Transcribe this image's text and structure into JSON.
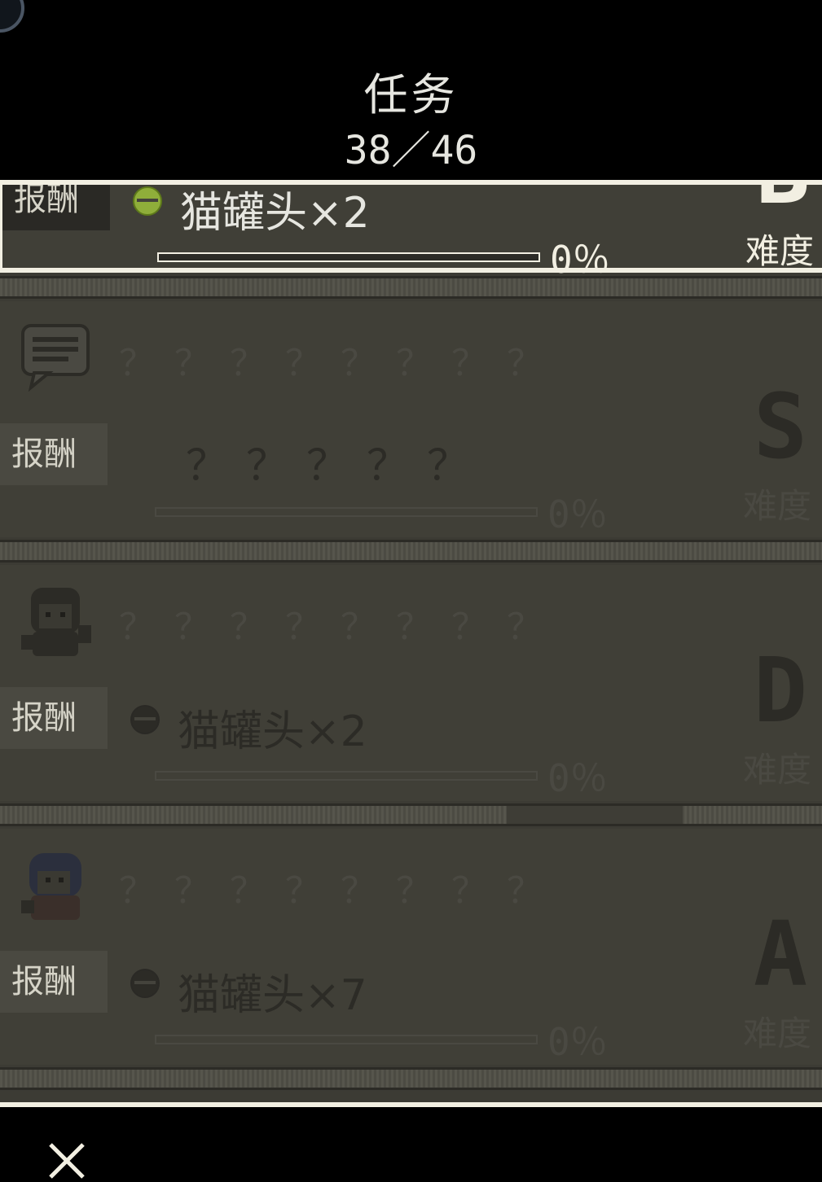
{
  "header": {
    "title": "任务",
    "count": "38／46"
  },
  "quests": [
    {
      "reward_label": "报酬",
      "reward": "猫罐头×2",
      "percent": "0％",
      "progress": 0,
      "grade": "B",
      "grade_label": "难度"
    },
    {
      "icon": "speech-bubble-icon",
      "title": "？？？？？？？？",
      "reward_label": "报酬",
      "reward": "？？？？？",
      "percent": "0％",
      "progress": 0,
      "grade": "S",
      "grade_label": "难度"
    },
    {
      "icon": "character-portrait-icon",
      "title": "？？？？？？？？",
      "reward_label": "报酬",
      "reward": "猫罐头×2",
      "percent": "0％",
      "progress": 0,
      "grade": "D",
      "grade_label": "难度"
    },
    {
      "icon": "character-portrait-icon",
      "title": "？？？？？？？？",
      "reward_label": "报酬",
      "reward": "猫罐头×7",
      "percent": "0％",
      "progress": 0,
      "grade": "A",
      "grade_label": "难度"
    }
  ],
  "footer": {
    "close_icon": "close-icon"
  },
  "colors": {
    "background": "#000000",
    "panel": "#403f37",
    "border": "#f2efe2"
  }
}
